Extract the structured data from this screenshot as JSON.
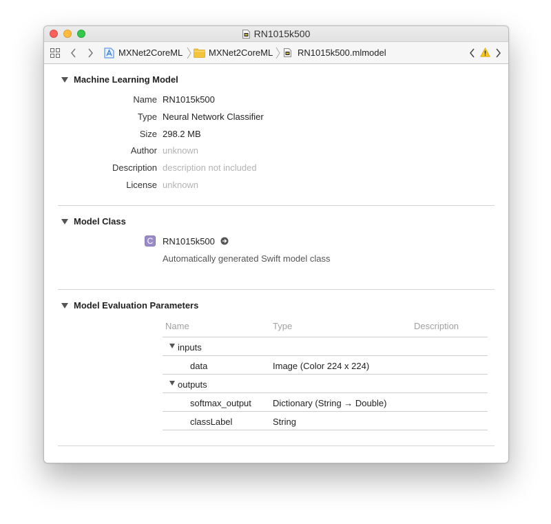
{
  "window": {
    "title": "RN1015k500"
  },
  "jumpbar": {
    "breadcrumbs": [
      {
        "label": "MXNet2CoreML",
        "icon": "xcode-project-icon"
      },
      {
        "label": "MXNet2CoreML",
        "icon": "folder-icon"
      },
      {
        "label": "RN1015k500.mlmodel",
        "icon": "mlmodel-file-icon"
      }
    ]
  },
  "model": {
    "section_title": "Machine Learning Model",
    "fields": [
      {
        "label": "Name",
        "value": "RN1015k500",
        "muted": false
      },
      {
        "label": "Type",
        "value": "Neural Network Classifier",
        "muted": false
      },
      {
        "label": "Size",
        "value": "298.2 MB",
        "muted": false
      },
      {
        "label": "Author",
        "value": "unknown",
        "muted": true
      },
      {
        "label": "Description",
        "value": "description not included",
        "muted": true
      },
      {
        "label": "License",
        "value": "unknown",
        "muted": true
      }
    ]
  },
  "model_class": {
    "section_title": "Model Class",
    "badge": "C",
    "class_name": "RN1015k500",
    "description": "Automatically generated Swift model class"
  },
  "evaluation": {
    "section_title": "Model Evaluation Parameters",
    "columns": [
      "Name",
      "Type",
      "Description"
    ],
    "groups": [
      {
        "name": "inputs",
        "rows": [
          {
            "name": "data",
            "type": "Image (Color 224 x 224)",
            "description": ""
          }
        ]
      },
      {
        "name": "outputs",
        "rows": [
          {
            "name": "softmax_output",
            "type": "Dictionary (String → Double)",
            "description": ""
          },
          {
            "name": "classLabel",
            "type": "String",
            "description": ""
          }
        ]
      }
    ]
  },
  "colors": {
    "accent_blue": "#3b82e6",
    "folder_yellow": "#f5c43d",
    "warning_yellow": "#f8c81c",
    "class_badge": "#9b8cc8"
  }
}
